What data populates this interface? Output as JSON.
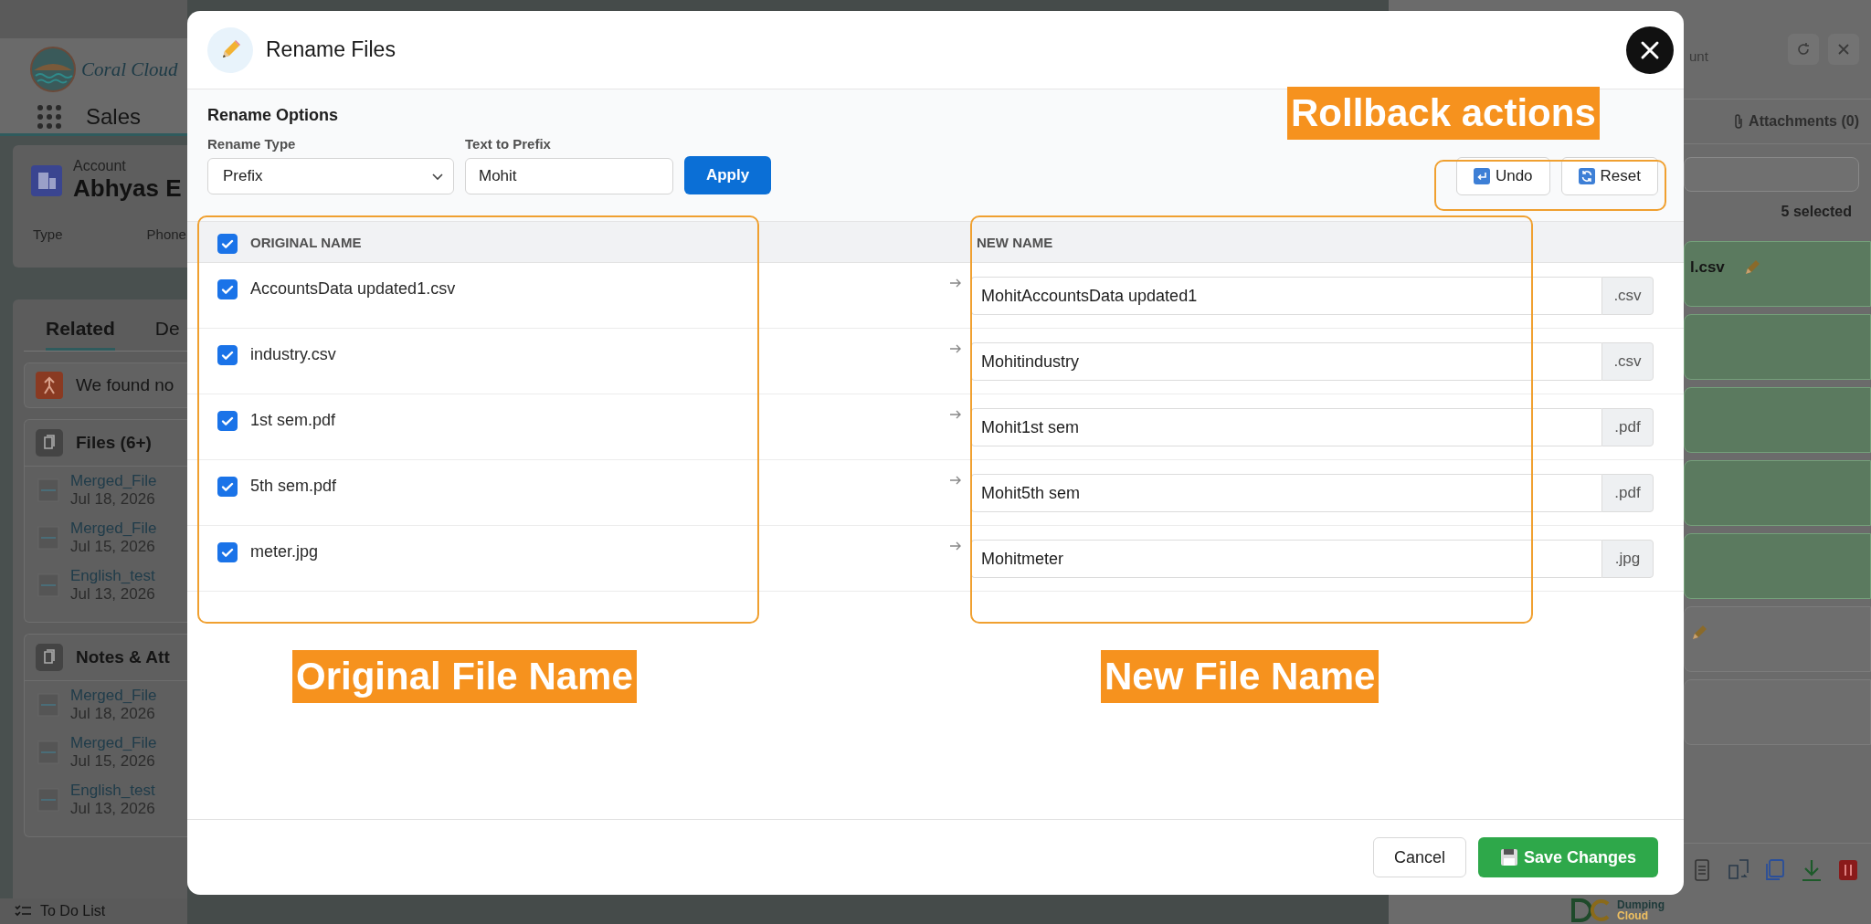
{
  "background_page": {
    "app_name": "Coral Cloud",
    "nav_app": "Sales",
    "record": {
      "object": "Account",
      "name": "Abhyas E",
      "fields": [
        "Type",
        "Phone"
      ]
    },
    "tabs": [
      {
        "label": "Related",
        "selected": true
      },
      {
        "label": "De",
        "selected": false
      }
    ],
    "notice": "We found no",
    "cards": [
      {
        "title": "Files (6+)",
        "items": [
          {
            "name": "Merged_File",
            "date": "Jul 18, 2026"
          },
          {
            "name": "Merged_File",
            "date": "Jul 15, 2026"
          },
          {
            "name": "English_test",
            "date": "Jul 13, 2026"
          }
        ]
      },
      {
        "title": "Notes & Att",
        "items": [
          {
            "name": "Merged_File",
            "date": "Jul 18, 2026"
          },
          {
            "name": "Merged_File",
            "date": "Jul 15, 2026"
          },
          {
            "name": "English_test",
            "date": "Jul 13, 2026"
          }
        ]
      }
    ],
    "utility_bar": "To Do List"
  },
  "side_panel": {
    "title": "unt",
    "attachments_tab": "Attachments (0)",
    "selection_count": "5 selected",
    "files": [
      {
        "name": "l.csv",
        "selected": true,
        "editable": true
      },
      {
        "selected": true,
        "editable": false
      },
      {
        "selected": true,
        "editable": false
      },
      {
        "selected": true,
        "editable": false
      },
      {
        "selected": true,
        "editable": false
      },
      {
        "selected": false,
        "editable": true
      },
      {
        "selected": false,
        "editable": false
      }
    ],
    "brand": [
      "Dumping",
      "Cloud"
    ]
  },
  "modal": {
    "title": "Rename Files",
    "section_title": "Rename Options",
    "rename_type": {
      "label": "Rename Type",
      "value": "Prefix"
    },
    "text_field": {
      "label": "Text to Prefix",
      "value": "Mohit"
    },
    "apply": "Apply",
    "undo": "Undo",
    "reset": "Reset",
    "columns": [
      "ORIGINAL NAME",
      "NEW NAME"
    ],
    "select_all": {
      "checked": true
    },
    "rows": [
      {
        "checked": true,
        "original": "AccountsData updated1.csv",
        "new_name": "MohitAccountsData updated1",
        "extension": ".csv"
      },
      {
        "checked": true,
        "original": "industry.csv",
        "new_name": "Mohitindustry",
        "extension": ".csv"
      },
      {
        "checked": true,
        "original": "1st sem.pdf",
        "new_name": "Mohit1st sem",
        "extension": ".pdf"
      },
      {
        "checked": true,
        "original": "5th sem.pdf",
        "new_name": "Mohit5th sem",
        "extension": ".pdf"
      },
      {
        "checked": true,
        "original": "meter.jpg",
        "new_name": "Mohitmeter",
        "extension": ".jpg"
      }
    ],
    "cancel": "Cancel",
    "save": "Save Changes"
  },
  "annotations": [
    {
      "text": "Rollback actions"
    },
    {
      "text": "Original File Name"
    },
    {
      "text": "New File Name"
    }
  ]
}
